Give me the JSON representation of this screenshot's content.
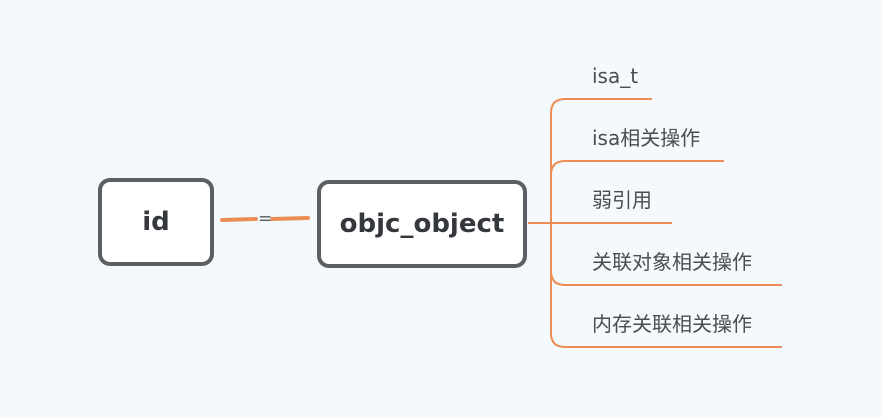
{
  "diagram": {
    "root": {
      "label": "id"
    },
    "relation": {
      "label": "="
    },
    "object": {
      "label": "objc_object"
    },
    "branches": [
      {
        "label": "isa_t"
      },
      {
        "label": "isa相关操作"
      },
      {
        "label": "弱引用"
      },
      {
        "label": "关联对象相关操作"
      },
      {
        "label": "内存关联相关操作"
      }
    ]
  },
  "colors": {
    "background": "#f4f9fd",
    "connector": "#ec8d55",
    "node_border": "#5b5e63",
    "node_text": "#34373c",
    "leaf_text": "#4a4d52"
  }
}
